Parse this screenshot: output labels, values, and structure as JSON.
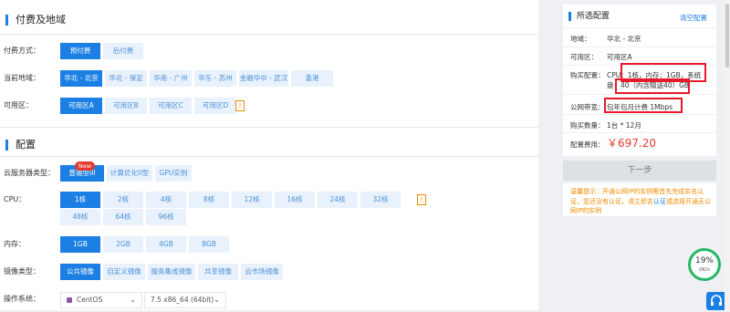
{
  "billing": {
    "section_title": "付费及地域",
    "pay_label": "付费方式：",
    "pay_options": [
      "预付费",
      "后付费"
    ],
    "region_label": "当前地域：",
    "regions": [
      "华北 - 北京",
      "华北 - 保定",
      "华南 - 广州",
      "华东 - 苏州",
      "金融华中 - 武汉",
      "香港"
    ],
    "zone_label": "可用区：",
    "zones": [
      "可用区A",
      "可用区B",
      "可用区C",
      "可用区D"
    ]
  },
  "config": {
    "section_title": "配置",
    "type_label": "云服务器类型：",
    "types": [
      "普通型III",
      "计算优化II型",
      "GPU实例"
    ],
    "new_badge": "New",
    "cpu_label": "CPU：",
    "cpu_options": [
      "1核",
      "2核",
      "4核",
      "8核",
      "12核",
      "16核",
      "24核",
      "32核",
      "48核",
      "64核",
      "96核"
    ],
    "mem_label": "内存：",
    "mem_options": [
      "1GB",
      "2GB",
      "4GB",
      "8GB"
    ],
    "image_label": "镜像类型：",
    "image_options": [
      "公共镜像",
      "自定义镜像",
      "服务集成镜像",
      "共享镜像",
      "云市场镜像"
    ],
    "os_label": "操作系统：",
    "os_select": "CentOS",
    "os_version": "7.5 x86_64 (64bit)"
  },
  "summary": {
    "title": "所选配置",
    "clear": "清空配置",
    "region_label": "地域：",
    "region_value": "华北 - 北京",
    "zone_label": "可用区：",
    "zone_value": "可用区A",
    "buy_label": "购买配置：",
    "buy_value_1": "CPU：1核，内存：1GB，系统",
    "buy_value_2": "盘：40（内含赠送40）GB",
    "bandwidth_label": "公网带宽：",
    "bandwidth_value": "包年包月计费 1Mbps",
    "count_label": "购买数量：",
    "count_value": "1台 * 12月",
    "fee_label": "配置费用：",
    "fee_value": "￥697.20"
  },
  "next_button": "下一步",
  "tip": {
    "part1": "温馨提示：开通公网IP的实例需首先完成实名认证，您还没有认证，请立即去",
    "link1": "认证",
    "part2": "或选择开通无公网IP的实例"
  },
  "gauge": {
    "percent": "19%",
    "speed": "0K/s"
  },
  "colors": {
    "primary": "#1b7fe3",
    "light": "#e9f2fc",
    "price": "#e23b2e",
    "warning": "#f08c00",
    "highlight": "#e8192c"
  }
}
